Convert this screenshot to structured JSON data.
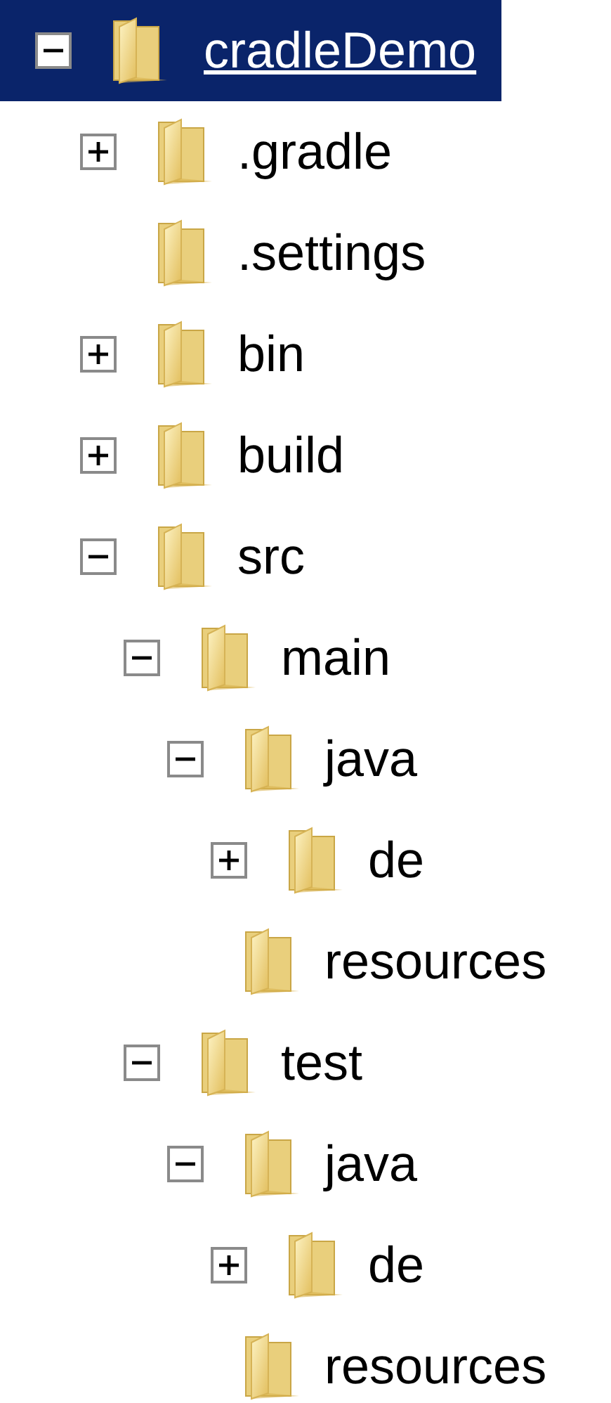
{
  "tree": [
    {
      "label": "cradleDemo",
      "selected": true,
      "expanded": true,
      "children": [
        {
          "label": ".gradle",
          "selected": false,
          "expanded": false
        },
        {
          "label": ".settings",
          "selected": false
        },
        {
          "label": "bin",
          "selected": false,
          "expanded": false
        },
        {
          "label": "build",
          "selected": false,
          "expanded": false
        },
        {
          "label": "src",
          "selected": false,
          "expanded": true,
          "children": [
            {
              "label": "main",
              "selected": false,
              "expanded": true,
              "children": [
                {
                  "label": "java",
                  "selected": false,
                  "expanded": true,
                  "children": [
                    {
                      "label": "de",
                      "selected": false,
                      "expanded": false
                    }
                  ]
                },
                {
                  "label": "resources",
                  "selected": false
                }
              ]
            },
            {
              "label": "test",
              "selected": false,
              "expanded": true,
              "children": [
                {
                  "label": "java",
                  "selected": false,
                  "expanded": true,
                  "children": [
                    {
                      "label": "de",
                      "selected": false,
                      "expanded": false
                    }
                  ]
                },
                {
                  "label": "resources",
                  "selected": false
                }
              ]
            }
          ]
        }
      ]
    }
  ]
}
